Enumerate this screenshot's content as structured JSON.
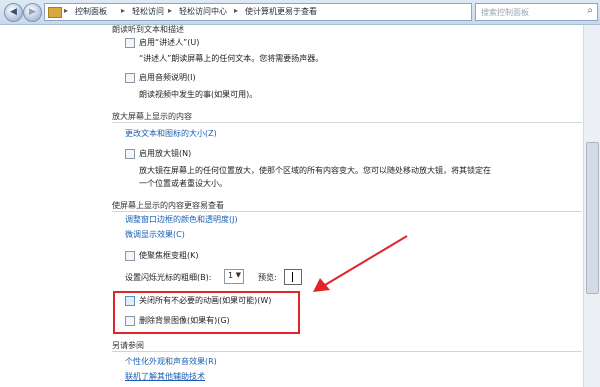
{
  "window": {
    "breadcrumbs": [
      "控制面板",
      "轻松访问",
      "轻松访问中心",
      "使计算机更易于查看"
    ],
    "search_placeholder": "搜索控制面板",
    "nav_back": "◀",
    "nav_fwd": "▶",
    "refresh": "↻",
    "addr_dropdown": "▾",
    "sep": "▸"
  },
  "narrator_section": {
    "heading": "朗读听到文本和描述",
    "narrator_checkbox": "启用“讲述人”(U)",
    "narrator_desc": "“讲述人”朗读屏幕上的任何文本。您将需要扬声器。",
    "audio_desc_checkbox": "启用音频说明(I)",
    "audio_desc_desc": "朗读视频中发生的事(如果可用)。"
  },
  "magnify_section": {
    "heading": "放大屏幕上显示的内容",
    "resize_link": "更改文本和图标的大小(Z)",
    "magnifier_checkbox": "启用放大镜(N)",
    "magnifier_desc_1": "放大镜在屏幕上的任何位置放大，使那个区域的所有内容变大。您可以随处移动放大镜，将其锁定在",
    "magnifier_desc_2": "一个位置或者重设大小。"
  },
  "easier_section": {
    "heading": "使屏幕上显示的内容更容易查看",
    "color_link": "调整窗口边框的颜色和透明度(J)",
    "display_link": "微调显示效果(C)",
    "focus_checkbox": "使聚焦框变粗(K)",
    "cursor_label": "设置闪烁光标的粗细(B):",
    "cursor_value": "1",
    "preview_label": "预览:",
    "animations_checkbox": "关闭所有不必要的动画(如果可能)(W)",
    "background_checkbox": "删除背景图像(如果有)(G)"
  },
  "see_also": {
    "heading": "另请参阅",
    "personalize_link": "个性化外观和声音效果(R)",
    "learn_link": "联机了解其他辅助技术"
  },
  "colors": {
    "link": "#1a5fb4",
    "highlight_box": "#e0252a"
  }
}
